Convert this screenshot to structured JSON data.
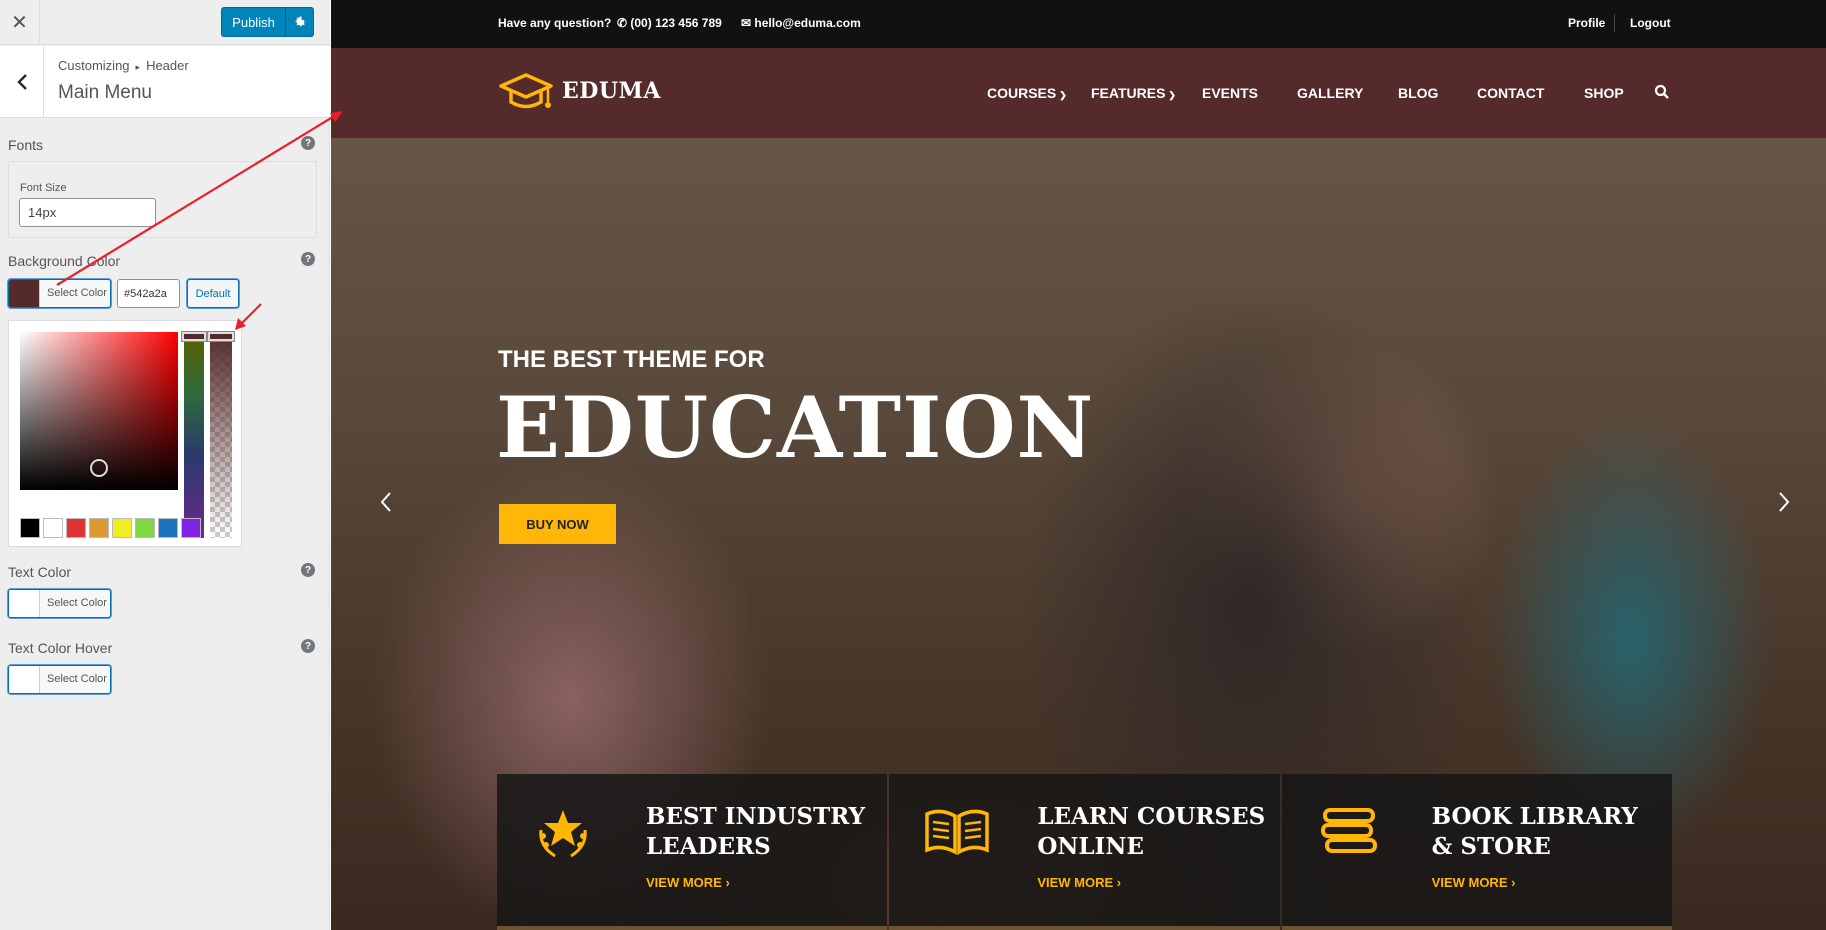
{
  "customizer": {
    "publish_label": "Publish",
    "breadcrumb_root": "Customizing",
    "breadcrumb_separator": "▸",
    "breadcrumb_parent": "Header",
    "section_title": "Main Menu",
    "fonts": {
      "title": "Fonts",
      "font_size_label": "Font Size",
      "font_size_value": "14px"
    },
    "background_color": {
      "title": "Background Color",
      "select_label": "Select Color",
      "hex_value": "#542a2a",
      "default_label": "Default",
      "swatch_color": "#542a2a"
    },
    "palette": [
      "#000000",
      "#ffffff",
      "#dd3333",
      "#dd9933",
      "#eeee22",
      "#81d742",
      "#1e73be",
      "#8224e3"
    ],
    "text_color": {
      "title": "Text Color",
      "select_label": "Select Color"
    },
    "text_color_hover": {
      "title": "Text Color Hover",
      "select_label": "Select Color"
    }
  },
  "preview": {
    "topbar": {
      "question": "Have any question?",
      "phone": "(00) 123 456 789",
      "email": "hello@eduma.com",
      "profile": "Profile",
      "logout": "Logout"
    },
    "logo_text": "EDUMA",
    "nav": [
      "COURSES",
      "FEATURES",
      "EVENTS",
      "GALLERY",
      "BLOG",
      "CONTACT",
      "SHOP"
    ],
    "hero": {
      "subtitle": "THE BEST THEME FOR",
      "title": "EDUCATION",
      "button": "BUY NOW"
    },
    "features": [
      {
        "title1": "BEST INDUSTRY",
        "title2": "LEADERS",
        "link": "VIEW MORE",
        "icon": "award-star-icon"
      },
      {
        "title1": "LEARN COURSES",
        "title2": "ONLINE",
        "link": "VIEW MORE",
        "icon": "open-book-icon"
      },
      {
        "title1": "BOOK LIBRARY",
        "title2": "& STORE",
        "link": "VIEW MORE",
        "icon": "books-stack-icon"
      }
    ],
    "accent_color": "#ffb606",
    "header_color": "#542a2a"
  },
  "annotation_color": "#e8202a"
}
